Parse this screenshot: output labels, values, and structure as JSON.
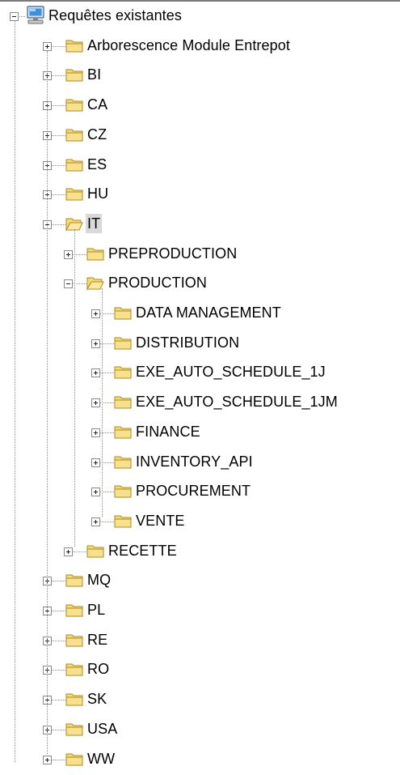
{
  "tree": {
    "root": {
      "label": "Requêtes existantes",
      "icon": "computer-icon"
    },
    "top_nodes": [
      {
        "label": "Arborescence Module Entrepot",
        "expanded": false
      },
      {
        "label": "BI",
        "expanded": false
      },
      {
        "label": "CA",
        "expanded": false
      },
      {
        "label": "CZ",
        "expanded": false
      },
      {
        "label": "ES",
        "expanded": false
      },
      {
        "label": "HU",
        "expanded": false
      },
      {
        "label": "IT",
        "expanded": true,
        "selected": true
      },
      {
        "label": "MQ",
        "expanded": false
      },
      {
        "label": "PL",
        "expanded": false
      },
      {
        "label": "RE",
        "expanded": false
      },
      {
        "label": "RO",
        "expanded": false
      },
      {
        "label": "SK",
        "expanded": false
      },
      {
        "label": "USA",
        "expanded": false
      },
      {
        "label": "WW",
        "expanded": false
      }
    ],
    "it_children": [
      {
        "label": "PREPRODUCTION",
        "expanded": false
      },
      {
        "label": "PRODUCTION",
        "expanded": true
      },
      {
        "label": "RECETTE",
        "expanded": false
      }
    ],
    "production_children": [
      {
        "label": "DATA MANAGEMENT"
      },
      {
        "label": "DISTRIBUTION"
      },
      {
        "label": "EXE_AUTO_SCHEDULE_1J"
      },
      {
        "label": "EXE_AUTO_SCHEDULE_1JM"
      },
      {
        "label": "FINANCE"
      },
      {
        "label": "INVENTORY_API"
      },
      {
        "label": "PROCUREMENT"
      },
      {
        "label": "VENTE"
      }
    ],
    "colors": {
      "folder_fill": "#f3da7a",
      "folder_border": "#b08a1c",
      "selection": "#d9d9d9",
      "connector": "#8c8c8c"
    }
  }
}
